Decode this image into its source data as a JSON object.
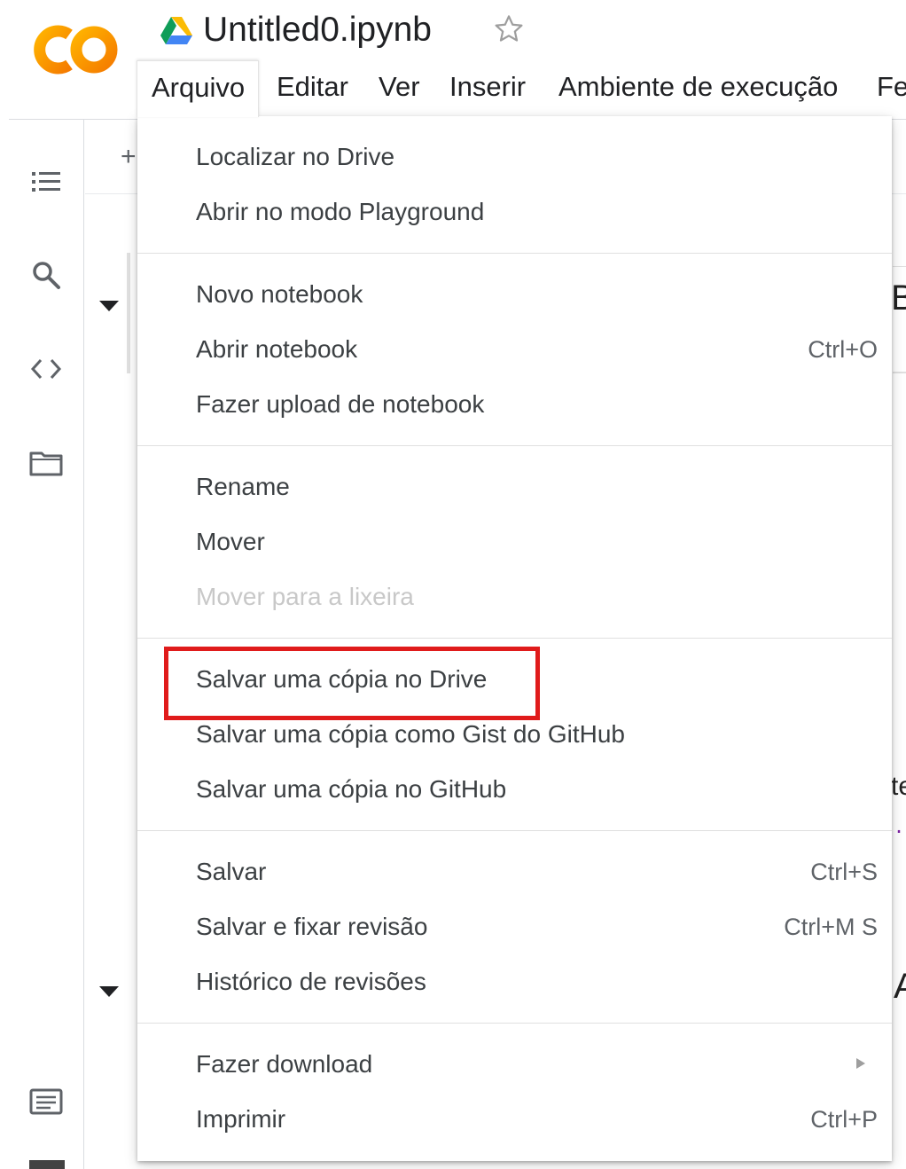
{
  "header": {
    "doc_title": "Untitled0.ipynb",
    "logo_icon": "colab-logo",
    "drive_icon": "google-drive-icon",
    "star_icon": "star-outline-icon"
  },
  "menubar": {
    "items": [
      {
        "label": "Arquivo",
        "active": true
      },
      {
        "label": "Editar"
      },
      {
        "label": "Ver"
      },
      {
        "label": "Inserir"
      },
      {
        "label": "Ambiente de execução"
      },
      {
        "label": "Fe"
      }
    ]
  },
  "sidebar": {
    "icons": [
      "table-of-contents-icon",
      "search-icon",
      "code-snippets-icon",
      "files-folder-icon",
      "terminal-icon"
    ]
  },
  "notebook_fragments": {
    "add_symbol": "+",
    "peek_top": "B",
    "peek_mid": "te",
    "peek_code": ".r",
    "peek_bottom": "A"
  },
  "file_menu": {
    "groups": [
      {
        "items": [
          {
            "label": "Localizar no Drive",
            "shortcut": ""
          },
          {
            "label": "Abrir no modo Playground",
            "shortcut": ""
          }
        ]
      },
      {
        "items": [
          {
            "label": "Novo notebook",
            "shortcut": ""
          },
          {
            "label": "Abrir notebook",
            "shortcut": "Ctrl+O"
          },
          {
            "label": "Fazer upload de notebook",
            "shortcut": ""
          }
        ]
      },
      {
        "items": [
          {
            "label": "Rename",
            "shortcut": ""
          },
          {
            "label": "Mover",
            "shortcut": ""
          },
          {
            "label": "Mover para a lixeira",
            "shortcut": "",
            "disabled": true
          }
        ]
      },
      {
        "items": [
          {
            "label": "Salvar uma cópia no Drive",
            "shortcut": "",
            "highlighted": true
          },
          {
            "label": "Salvar uma cópia como Gist do GitHub",
            "shortcut": ""
          },
          {
            "label": "Salvar uma cópia no GitHub",
            "shortcut": ""
          }
        ]
      },
      {
        "items": [
          {
            "label": "Salvar",
            "shortcut": "Ctrl+S"
          },
          {
            "label": "Salvar e fixar revisão",
            "shortcut": "Ctrl+M S"
          },
          {
            "label": "Histórico de revisões",
            "shortcut": ""
          }
        ]
      },
      {
        "items": [
          {
            "label": "Fazer download",
            "shortcut": "",
            "submenu": true,
            "submenu_icon": "submenu-arrow-icon"
          },
          {
            "label": "Imprimir",
            "shortcut": "Ctrl+P"
          }
        ]
      }
    ],
    "highlight_color": "#e01b1b"
  }
}
